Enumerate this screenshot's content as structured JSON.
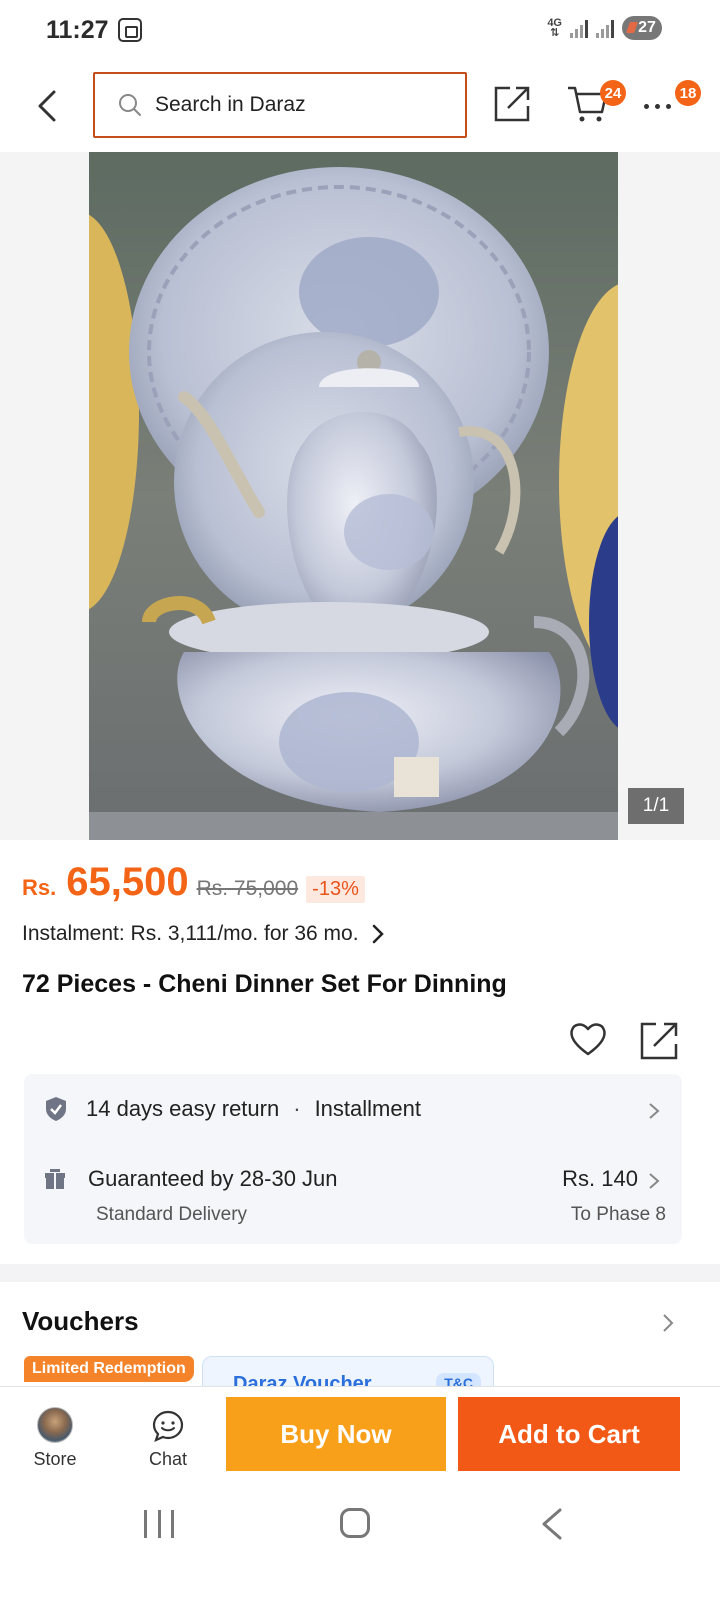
{
  "status_bar": {
    "time": "11:27",
    "network": "4G",
    "battery": "27"
  },
  "header": {
    "search_placeholder": "Search in Daraz",
    "cart_count": "24",
    "more_count": "18"
  },
  "gallery": {
    "counter": "1/1"
  },
  "product": {
    "currency": "Rs.",
    "price": "65,500",
    "old_price": "Rs. 75,000",
    "discount": "-13%",
    "instalment": "Instalment: Rs. 3,111/mo. for 36 mo.",
    "title": "72 Pieces - Cheni Dinner Set For Dinning"
  },
  "service": {
    "return_text": "14 days easy return",
    "separator": "·",
    "installment_text": "Installment",
    "guarantee_text": "Guaranteed by 28-30 Jun",
    "delivery_type": "Standard Delivery",
    "delivery_price": "Rs. 140",
    "delivery_location": "To Phase 8"
  },
  "vouchers": {
    "title": "Vouchers",
    "limited_badge": "Limited Redemption",
    "voucher_title": "Daraz Voucher",
    "tc_label": "T&C"
  },
  "bottom_bar": {
    "store_label": "Store",
    "chat_label": "Chat",
    "buy_now_label": "Buy Now",
    "add_to_cart_label": "Add to Cart"
  },
  "colors": {
    "brand_orange": "#f36416",
    "buy_now": "#f9a01b",
    "add_to_cart": "#f25916"
  }
}
